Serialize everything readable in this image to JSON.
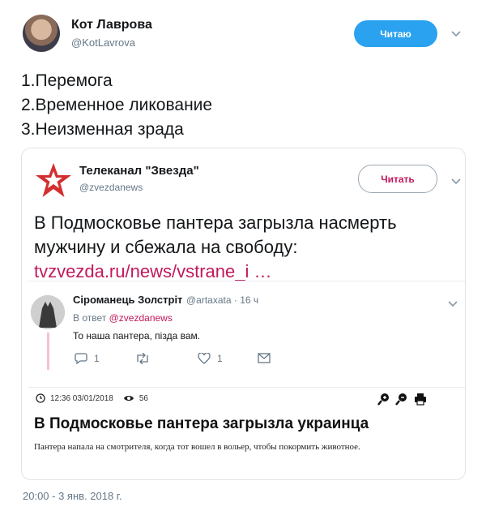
{
  "tweet": {
    "author_name": "Кот Лаврова",
    "author_handle": "@KotLavrova",
    "follow_label": "Читаю",
    "lines": [
      "1.Перемога",
      "2.Временное ликование",
      "3.Неизменная зрада"
    ],
    "timestamp": "20:00 - 3 янв. 2018 г."
  },
  "quoted": {
    "author_name": "Телеканал \"Звезда\"",
    "author_handle": "@zvezdanews",
    "follow_label": "Читать",
    "text_line1": "В Подмосковье пантера загрызла насмерть",
    "text_line2": "мужчину и сбежала на свободу:",
    "link": "tvzvezda.ru/news/vstrane_i …"
  },
  "reply": {
    "author_name": "Сіроманець Золстріт",
    "author_handle": "@artaxata · 16 ч",
    "reply_prefix": "В ответ",
    "reply_to": "@zvezdanews",
    "text": "То наша пантера, пізда вам.",
    "replies_count": "1",
    "likes_count": "1"
  },
  "article": {
    "datetime": "12:36 03/01/2018",
    "views": "56",
    "title": "В Подмосковье пантера загрызла украинца",
    "body": "Пантера напала на смотрителя, когда тот вошел в вольер, чтобы покормить животное."
  },
  "colors": {
    "follow_bg": "#2aa2f0",
    "brand": "#c2185b",
    "muted": "#657786"
  }
}
